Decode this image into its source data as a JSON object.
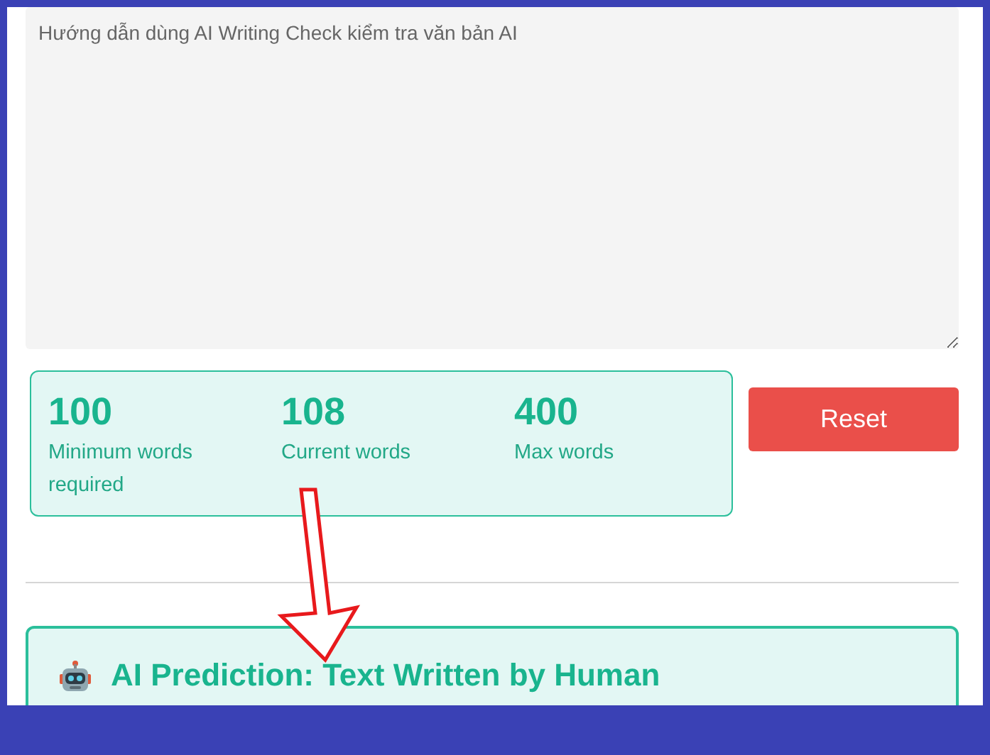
{
  "editor": {
    "value": "Hướng dẫn dùng AI Writing Check kiểm tra văn bản AI"
  },
  "stats": [
    {
      "value": "100",
      "label": "Minimum words required"
    },
    {
      "value": "108",
      "label": "Current words"
    },
    {
      "value": "400",
      "label": "Max words"
    }
  ],
  "reset_button": {
    "label": "Reset"
  },
  "prediction": {
    "title": "AI Prediction: Text Written by Human"
  }
}
